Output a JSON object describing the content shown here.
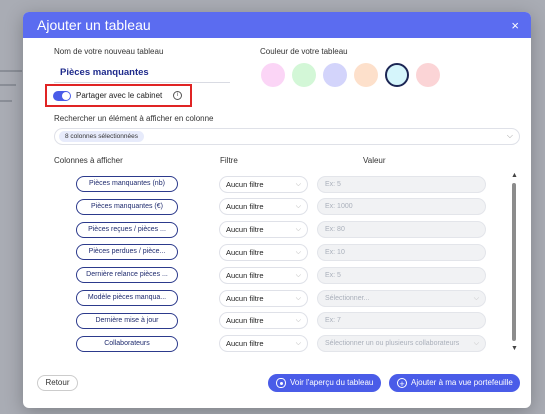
{
  "modal": {
    "title": "Ajouter un tableau",
    "close": "×"
  },
  "name_section": {
    "label": "Nom de votre nouveau tableau",
    "value": "Pièces manquantes"
  },
  "color_section": {
    "label": "Couleur de votre tableau",
    "swatches": [
      "#fbd5f6",
      "#d3f7d7",
      "#d3d4fb",
      "#fde0cb",
      "#d5f5fb",
      "#fbd4d6"
    ],
    "selected_index": 4
  },
  "share": {
    "label": "Partager avec le cabinet",
    "enabled": true,
    "info": "i"
  },
  "search": {
    "label": "Rechercher un élément à afficher en colonne",
    "chip": "8 colonnes sélectionnées",
    "chevron": "⌵"
  },
  "columns": {
    "header_columns": "Colonnes à afficher",
    "header_filter": "Filtre",
    "header_value": "Valeur",
    "rows": [
      {
        "name": "Pièces manquantes (nb)",
        "filter": "Aucun filtre",
        "value": "Ex: 5",
        "dropdown": false
      },
      {
        "name": "Pièces manquantes (€)",
        "filter": "Aucun filtre",
        "value": "Ex: 1000",
        "dropdown": false
      },
      {
        "name": "Pièces reçues / pièces ...",
        "filter": "Aucun filtre",
        "value": "Ex: 80",
        "dropdown": false
      },
      {
        "name": "Pièces perdues / pièce...",
        "filter": "Aucun filtre",
        "value": "Ex: 10",
        "dropdown": false
      },
      {
        "name": "Dernière relance pièces ...",
        "filter": "Aucun filtre",
        "value": "Ex: 5",
        "dropdown": false
      },
      {
        "name": "Modèle pièces manqua...",
        "filter": "Aucun filtre",
        "value": "Sélectionner...",
        "dropdown": true
      },
      {
        "name": "Dernière mise à jour",
        "filter": "Aucun filtre",
        "value": "Ex: 7",
        "dropdown": false
      },
      {
        "name": "Collaborateurs",
        "filter": "Aucun filtre",
        "value": "Sélectionner un ou plusieurs collaborateurs",
        "dropdown": true
      }
    ]
  },
  "footer": {
    "back": "Retour",
    "preview": "Voir l'aperçu du tableau",
    "add": "Ajouter à ma vue portefeuille"
  }
}
